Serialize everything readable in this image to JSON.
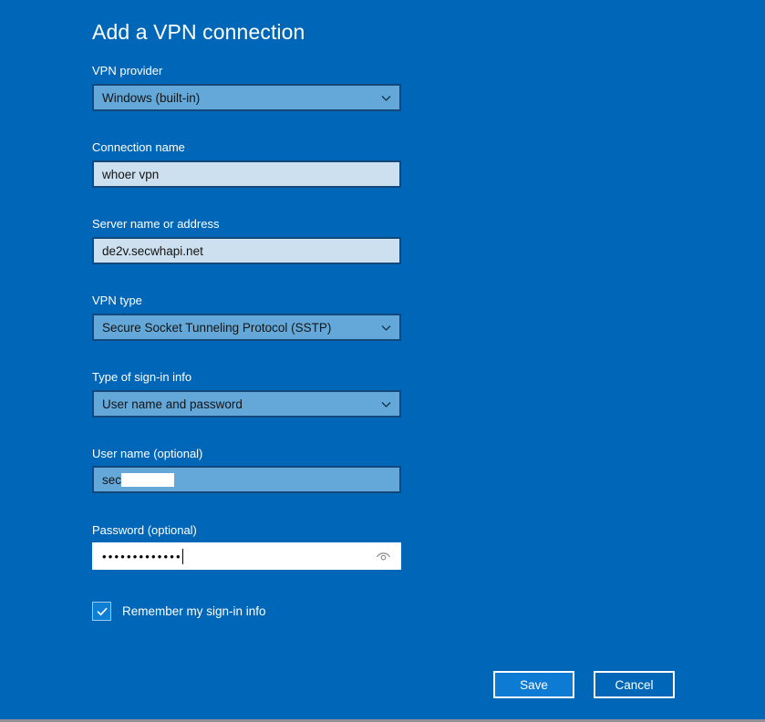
{
  "dialog": {
    "title": "Add a VPN connection"
  },
  "fields": {
    "vpn_provider": {
      "label": "VPN provider",
      "value": "Windows (built-in)",
      "control": "dropdown"
    },
    "connection_name": {
      "label": "Connection name",
      "value": "whoer vpn",
      "control": "textbox"
    },
    "server_name": {
      "label": "Server name or address",
      "value": "de2v.secwhapi.net",
      "control": "textbox"
    },
    "vpn_type": {
      "label": "VPN type",
      "value": "Secure Socket Tunneling Protocol (SSTP)",
      "control": "dropdown"
    },
    "signin_type": {
      "label": "Type of sign-in info",
      "value": "User name and password",
      "control": "dropdown"
    },
    "user_name": {
      "label": "User name (optional)",
      "value": "sec",
      "redacted": true,
      "control": "textbox"
    },
    "password": {
      "label": "Password (optional)",
      "value": "•••••••••••••",
      "masked": true,
      "focused": true,
      "reveal_icon": "eye-icon",
      "control": "password"
    }
  },
  "remember": {
    "label": "Remember my sign-in info",
    "checked": true
  },
  "buttons": {
    "save": "Save",
    "cancel": "Cancel"
  },
  "icons": {
    "chevron": "chevron-down-icon",
    "check": "checkmark-icon",
    "eye": "eye-reveal-icon"
  },
  "colors": {
    "background": "#0067b8",
    "control_fill": "#63a8d8",
    "textbox_fill": "#cde0ef",
    "control_border": "#14477a",
    "accent_button": "#0d7ad4",
    "text_light": "#ffffff",
    "text_dark": "#141414"
  }
}
